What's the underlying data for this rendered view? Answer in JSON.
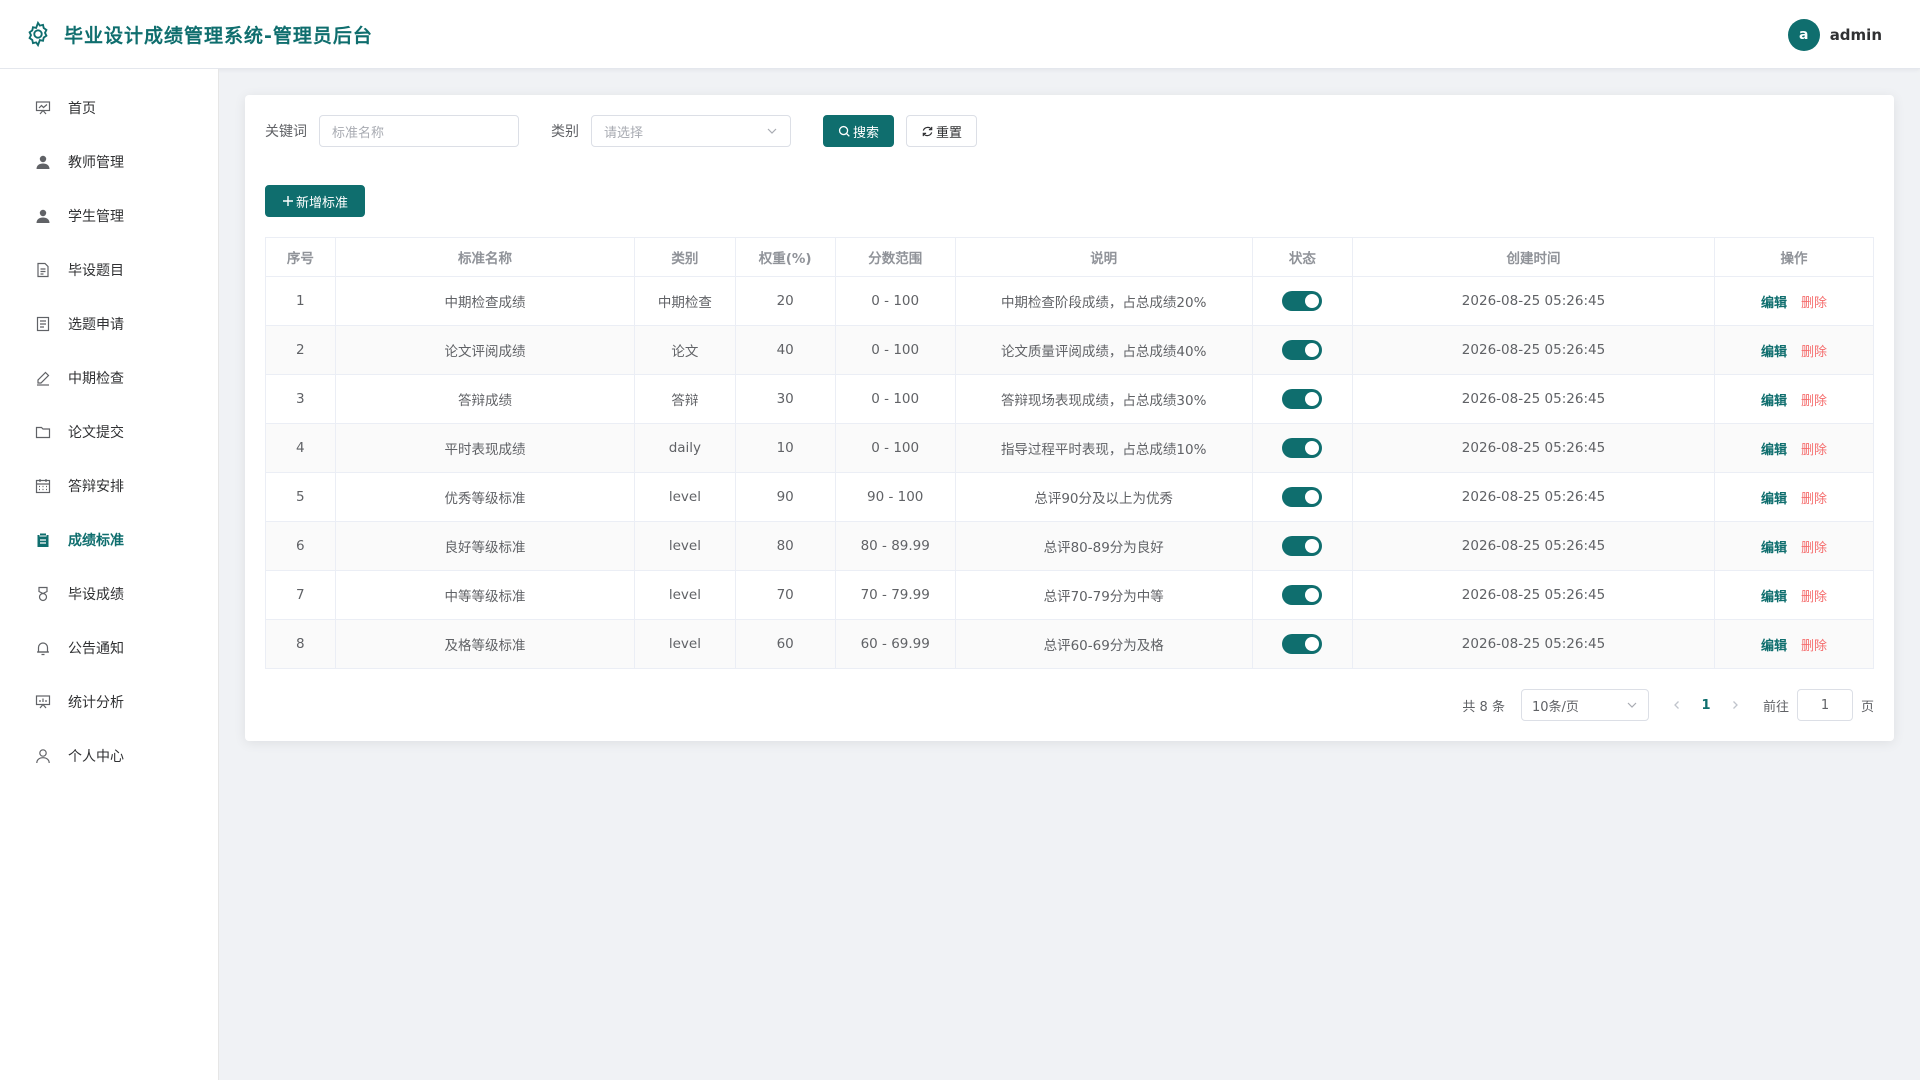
{
  "header": {
    "title": "毕业设计成绩管理系统-管理员后台",
    "user_initial": "a",
    "username": "admin"
  },
  "sidebar": {
    "items": [
      {
        "label": "首页",
        "icon": "presentation-icon"
      },
      {
        "label": "教师管理",
        "icon": "user-solid-icon"
      },
      {
        "label": "学生管理",
        "icon": "user-solid-icon"
      },
      {
        "label": "毕设题目",
        "icon": "document-icon"
      },
      {
        "label": "选题申请",
        "icon": "document-list-icon"
      },
      {
        "label": "中期检查",
        "icon": "pen-icon"
      },
      {
        "label": "论文提交",
        "icon": "folder-icon"
      },
      {
        "label": "答辩安排",
        "icon": "calendar-icon"
      },
      {
        "label": "成绩标准",
        "icon": "clipboard-icon",
        "active": true
      },
      {
        "label": "毕设成绩",
        "icon": "medal-icon"
      },
      {
        "label": "公告通知",
        "icon": "bell-icon"
      },
      {
        "label": "统计分析",
        "icon": "data-board-icon"
      },
      {
        "label": "个人中心",
        "icon": "user-outline-icon"
      }
    ]
  },
  "filters": {
    "keyword_label": "关键词",
    "keyword_placeholder": "标准名称",
    "category_label": "类别",
    "category_placeholder": "请选择",
    "search_label": "搜索",
    "reset_label": "重置"
  },
  "add_button_label": "新增标准",
  "table": {
    "headers": [
      "序号",
      "标准名称",
      "类别",
      "权重(%)",
      "分数范围",
      "说明",
      "状态",
      "创建时间",
      "操作"
    ],
    "rows": [
      {
        "no": "1",
        "name": "中期检查成绩",
        "category": "中期检查",
        "weight": "20",
        "range": "0 - 100",
        "desc": "中期检查阶段成绩，占总成绩20%",
        "enabled": true,
        "created": "2026-08-25 05:26:45"
      },
      {
        "no": "2",
        "name": "论文评阅成绩",
        "category": "论文",
        "weight": "40",
        "range": "0 - 100",
        "desc": "论文质量评阅成绩，占总成绩40%",
        "enabled": true,
        "created": "2026-08-25 05:26:45"
      },
      {
        "no": "3",
        "name": "答辩成绩",
        "category": "答辩",
        "weight": "30",
        "range": "0 - 100",
        "desc": "答辩现场表现成绩，占总成绩30%",
        "enabled": true,
        "created": "2026-08-25 05:26:45"
      },
      {
        "no": "4",
        "name": "平时表现成绩",
        "category": "daily",
        "weight": "10",
        "range": "0 - 100",
        "desc": "指导过程平时表现，占总成绩10%",
        "enabled": true,
        "created": "2026-08-25 05:26:45"
      },
      {
        "no": "5",
        "name": "优秀等级标准",
        "category": "level",
        "weight": "90",
        "range": "90 - 100",
        "desc": "总评90分及以上为优秀",
        "enabled": true,
        "created": "2026-08-25 05:26:45"
      },
      {
        "no": "6",
        "name": "良好等级标准",
        "category": "level",
        "weight": "80",
        "range": "80 - 89.99",
        "desc": "总评80-89分为良好",
        "enabled": true,
        "created": "2026-08-25 05:26:45"
      },
      {
        "no": "7",
        "name": "中等等级标准",
        "category": "level",
        "weight": "70",
        "range": "70 - 79.99",
        "desc": "总评70-79分为中等",
        "enabled": true,
        "created": "2026-08-25 05:26:45"
      },
      {
        "no": "8",
        "name": "及格等级标准",
        "category": "level",
        "weight": "60",
        "range": "60 - 69.99",
        "desc": "总评60-69分为及格",
        "enabled": true,
        "created": "2026-08-25 05:26:45"
      }
    ],
    "edit_label": "编辑",
    "delete_label": "删除"
  },
  "pagination": {
    "total_text": "共 8 条",
    "page_size": "10条/页",
    "current_page": "1",
    "goto_label": "前往",
    "goto_value": "1",
    "page_suffix": "页"
  },
  "colors": {
    "primary": "#0f6e6e",
    "danger": "#f56c6c"
  }
}
